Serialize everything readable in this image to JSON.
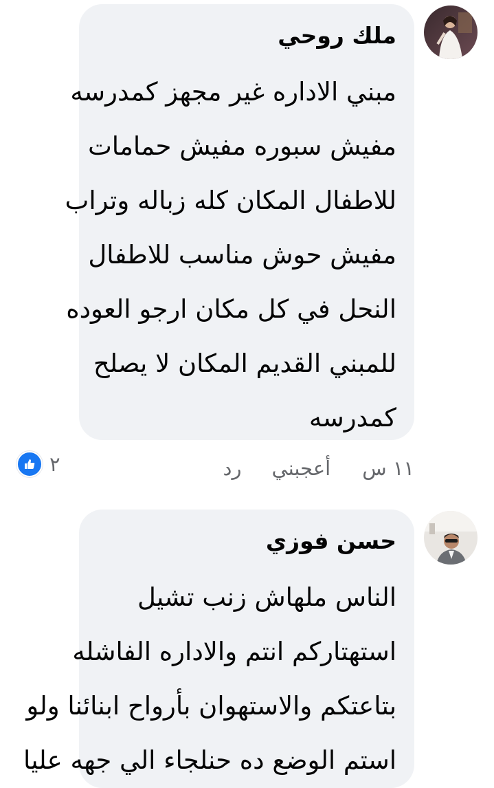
{
  "comments": [
    {
      "author": "ملك روحي",
      "lines": [
        "مبني الاداره غير مجهز كمدرسه",
        "مفيش سبوره مفيش حمامات",
        "للاطفال المكان كله زباله وتراب",
        "مفيش حوش مناسب للاطفال",
        "النحل في كل مكان ارجو العوده",
        "للمبني القديم المكان لا يصلح",
        "كمدرسه"
      ],
      "time": "١١ س",
      "like_label": "أعجبني",
      "reply_label": "رد",
      "reaction_count": "٢",
      "reaction_icon": "thumbs-up-icon"
    },
    {
      "author": "حسن فوزي",
      "lines": [
        "الناس ملهاش زنب تشيل",
        "استهتاركم انتم والاداره الفاشله",
        "بتاعتكم والاستهوان بأرواح ابنائنا ولو",
        "استم الوضع ده حنلجاء الي جهه عليا"
      ]
    }
  ],
  "colors": {
    "bubble": "#f0f2f5",
    "meta_text": "#65676b",
    "like_blue": "#1877f2"
  }
}
